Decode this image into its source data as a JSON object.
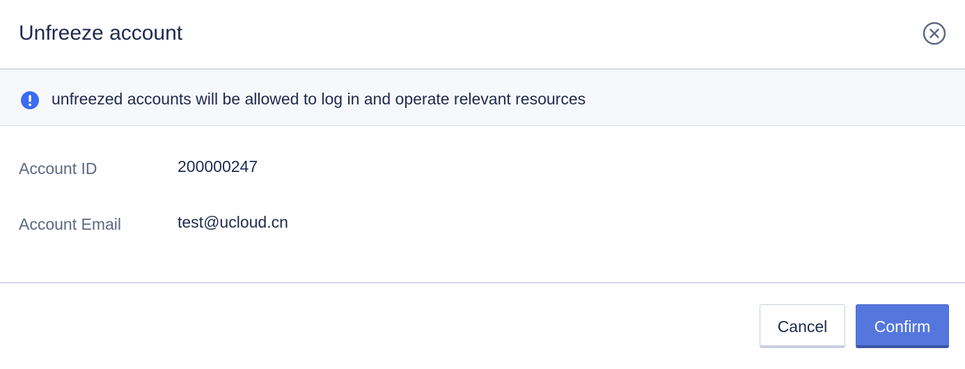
{
  "dialog": {
    "title": "Unfreeze account",
    "close_icon": "close-circle-icon"
  },
  "notice": {
    "icon": "info-exclamation-icon",
    "icon_color": "#3b6cf2",
    "text": "unfreezed accounts will be allowed to log in and operate relevant resources"
  },
  "fields": [
    {
      "label": "Account ID",
      "value": "200000247"
    },
    {
      "label": "Account Email",
      "value": "test@ucloud.cn"
    }
  ],
  "footer": {
    "cancel_label": "Cancel",
    "confirm_label": "Confirm",
    "accent_color": "#5577dd"
  }
}
